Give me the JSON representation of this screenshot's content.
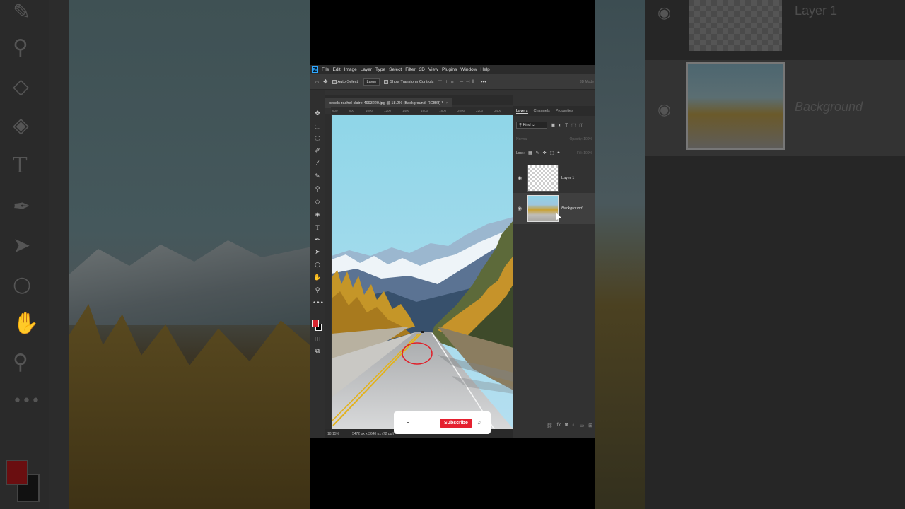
{
  "menubar": {
    "app_icon": "Ps",
    "items": [
      "File",
      "Edit",
      "Image",
      "Layer",
      "Type",
      "Select",
      "Filter",
      "3D",
      "View",
      "Plugins",
      "Window",
      "Help"
    ]
  },
  "options": {
    "auto_select_label": "Auto-Select:",
    "target_value": "Layer",
    "transform_label": "Show Transform Controls",
    "more_icon": "•••",
    "mode_3d": "3D Mode"
  },
  "document": {
    "tab_title": "pexels-rachel-claire-4993220.jpg @ 18.2% (Background, RGB/8) *",
    "ruler_ticks": [
      "600",
      "800",
      "1000",
      "1200",
      "1400",
      "1600",
      "1800",
      "2000",
      "2200",
      "2400",
      "2600",
      "2800",
      "3000",
      "3200",
      "3400",
      "3600",
      "3800",
      "4000"
    ],
    "zoom": "18.15%",
    "doc_info": "5472 px x 3648 px (72 ppi)"
  },
  "layers_panel": {
    "tabs": [
      "Layers",
      "Channels",
      "Properties"
    ],
    "kind_label": "Kind",
    "blend_mode": "Normal",
    "opacity_label": "Opacity: 100%",
    "lock_label": "Lock:",
    "fill_label": "Fill: 100%",
    "layers": [
      {
        "name": "Layer 1",
        "visible": true
      },
      {
        "name": "Background",
        "visible": true
      }
    ],
    "footer_icons": [
      "link-icon",
      "fx-icon",
      "mask-icon",
      "adjustment-icon",
      "group-icon",
      "new-layer-icon"
    ]
  },
  "colors": {
    "foreground": "#d6232f",
    "background": "#000000",
    "accent_subscribe": "#e5202f",
    "annotation_circle": "#e0202a"
  },
  "background_overlay": {
    "layer_top": "Layer 1",
    "layer_bottom": "Background"
  },
  "subscribe": {
    "label": "Subscribe"
  }
}
